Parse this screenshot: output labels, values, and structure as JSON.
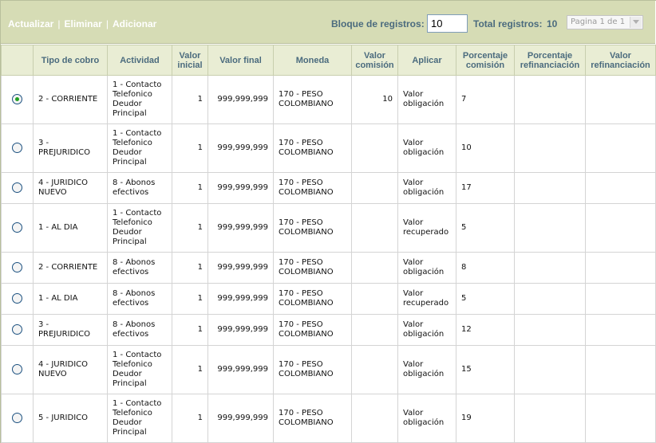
{
  "toolbar": {
    "actions": [
      "Actualizar",
      "Eliminar",
      "Adicionar"
    ],
    "block_label": "Bloque de registros:",
    "block_value": "10",
    "total_label": "Total registros:",
    "total_value": "10",
    "page_label": "Pagina 1 de 1"
  },
  "table": {
    "headers": [
      "",
      "Tipo de cobro",
      "Actividad",
      "Valor inicial",
      "Valor final",
      "Moneda",
      "Valor comisión",
      "Aplicar",
      "Porcentaje comisión",
      "Porcentaje refinanciación",
      "Valor refinanciación"
    ],
    "rows": [
      {
        "selected": true,
        "tipo": "2 - CORRIENTE",
        "actividad": "1 - Contacto Telefonico Deudor Principal",
        "valor_inicial": "1",
        "valor_final": "999,999,999",
        "moneda": "170 - PESO COLOMBIANO",
        "valor_comision": "10",
        "aplicar": "Valor obligación",
        "porcentaje_comision": "7",
        "porcentaje_refinanciacion": "",
        "valor_refinanciacion": ""
      },
      {
        "selected": false,
        "tipo": "3 - PREJURIDICO",
        "actividad": "1 - Contacto Telefonico Deudor Principal",
        "valor_inicial": "1",
        "valor_final": "999,999,999",
        "moneda": "170 - PESO COLOMBIANO",
        "valor_comision": "",
        "aplicar": "Valor obligación",
        "porcentaje_comision": "10",
        "porcentaje_refinanciacion": "",
        "valor_refinanciacion": ""
      },
      {
        "selected": false,
        "tipo": "4 - JURIDICO NUEVO",
        "actividad": "8 - Abonos efectivos",
        "valor_inicial": "1",
        "valor_final": "999,999,999",
        "moneda": "170 - PESO COLOMBIANO",
        "valor_comision": "",
        "aplicar": "Valor obligación",
        "porcentaje_comision": "17",
        "porcentaje_refinanciacion": "",
        "valor_refinanciacion": ""
      },
      {
        "selected": false,
        "tipo": "1 - AL DIA",
        "actividad": "1 - Contacto Telefonico Deudor Principal",
        "valor_inicial": "1",
        "valor_final": "999,999,999",
        "moneda": "170 - PESO COLOMBIANO",
        "valor_comision": "",
        "aplicar": "Valor recuperado",
        "porcentaje_comision": "5",
        "porcentaje_refinanciacion": "",
        "valor_refinanciacion": ""
      },
      {
        "selected": false,
        "tipo": "2 - CORRIENTE",
        "actividad": "8 - Abonos efectivos",
        "valor_inicial": "1",
        "valor_final": "999,999,999",
        "moneda": "170 - PESO COLOMBIANO",
        "valor_comision": "",
        "aplicar": "Valor obligación",
        "porcentaje_comision": "8",
        "porcentaje_refinanciacion": "",
        "valor_refinanciacion": ""
      },
      {
        "selected": false,
        "tipo": "1 - AL DIA",
        "actividad": "8 - Abonos efectivos",
        "valor_inicial": "1",
        "valor_final": "999,999,999",
        "moneda": "170 - PESO COLOMBIANO",
        "valor_comision": "",
        "aplicar": "Valor recuperado",
        "porcentaje_comision": "5",
        "porcentaje_refinanciacion": "",
        "valor_refinanciacion": ""
      },
      {
        "selected": false,
        "tipo": "3 - PREJURIDICO",
        "actividad": "8 - Abonos efectivos",
        "valor_inicial": "1",
        "valor_final": "999,999,999",
        "moneda": "170 - PESO COLOMBIANO",
        "valor_comision": "",
        "aplicar": "Valor obligación",
        "porcentaje_comision": "12",
        "porcentaje_refinanciacion": "",
        "valor_refinanciacion": ""
      },
      {
        "selected": false,
        "tipo": "4 - JURIDICO NUEVO",
        "actividad": "1 - Contacto Telefonico Deudor Principal",
        "valor_inicial": "1",
        "valor_final": "999,999,999",
        "moneda": "170 - PESO COLOMBIANO",
        "valor_comision": "",
        "aplicar": "Valor obligación",
        "porcentaje_comision": "15",
        "porcentaje_refinanciacion": "",
        "valor_refinanciacion": ""
      },
      {
        "selected": false,
        "tipo": "5 - JURIDICO",
        "actividad": "1 - Contacto Telefonico Deudor Principal",
        "valor_inicial": "1",
        "valor_final": "999,999,999",
        "moneda": "170 - PESO COLOMBIANO",
        "valor_comision": "",
        "aplicar": "Valor obligación",
        "porcentaje_comision": "19",
        "porcentaje_refinanciacion": "",
        "valor_refinanciacion": ""
      }
    ]
  }
}
